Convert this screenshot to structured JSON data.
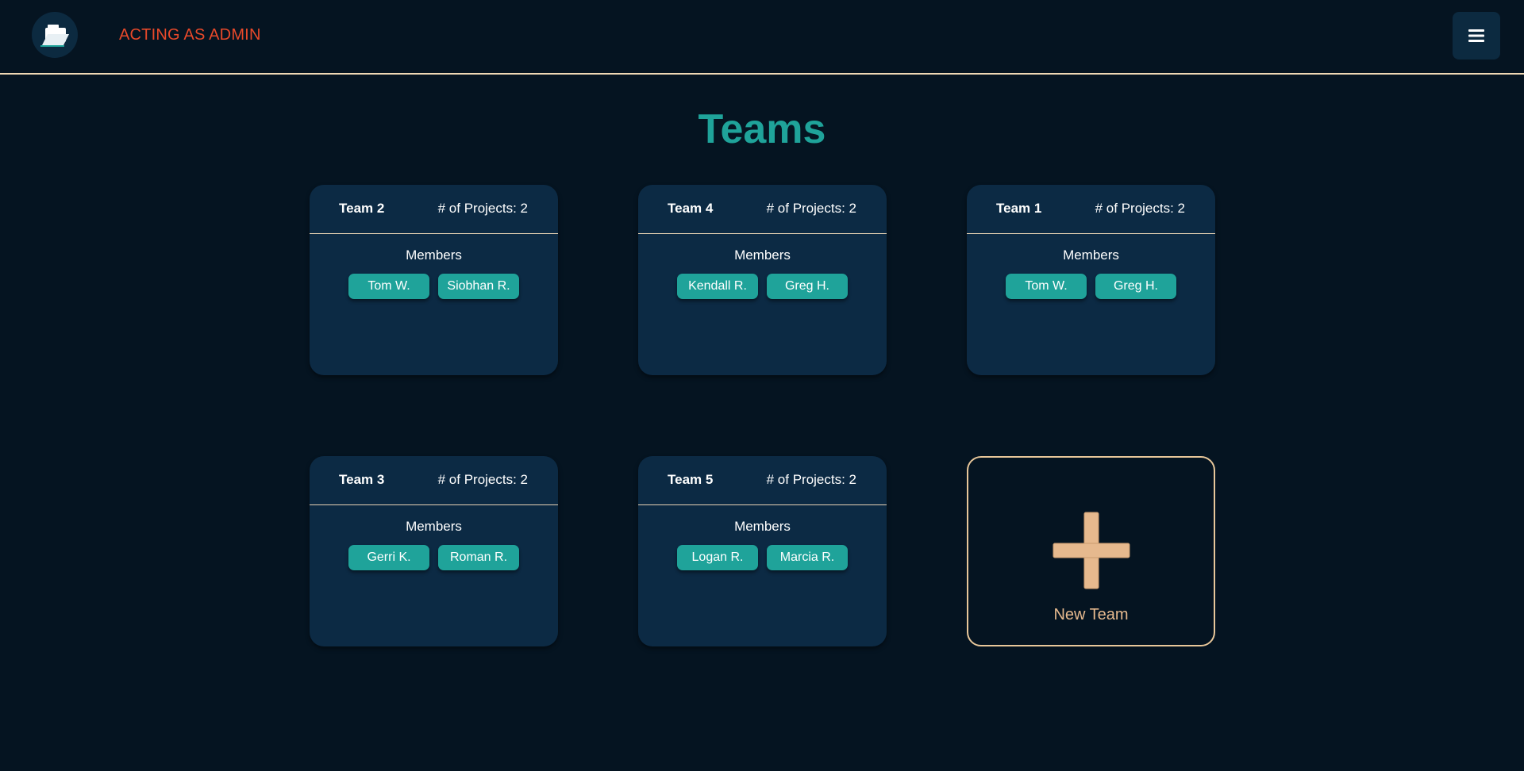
{
  "header": {
    "logo_icon": "folder-icon",
    "admin_label": "ACTING AS ADMIN",
    "menu_icon": "hamburger-menu-icon"
  },
  "page": {
    "title": "Teams"
  },
  "teams": [
    {
      "name": "Team 2",
      "projects_label": "# of Projects: 2",
      "members_label": "Members",
      "members": [
        "Tom W.",
        "Siobhan R."
      ]
    },
    {
      "name": "Team 4",
      "projects_label": "# of Projects: 2",
      "members_label": "Members",
      "members": [
        "Kendall R.",
        "Greg H."
      ]
    },
    {
      "name": "Team 1",
      "projects_label": "# of Projects: 2",
      "members_label": "Members",
      "members": [
        "Tom W.",
        "Greg H."
      ]
    },
    {
      "name": "Team 3",
      "projects_label": "# of Projects: 2",
      "members_label": "Members",
      "members": [
        "Gerri K.",
        "Roman R."
      ]
    },
    {
      "name": "Team 5",
      "projects_label": "# of Projects: 2",
      "members_label": "Members",
      "members": [
        "Logan R.",
        "Marcia R."
      ]
    }
  ],
  "new_team": {
    "icon": "plus-icon",
    "label": "New Team"
  },
  "colors": {
    "background": "#051421",
    "card": "#0c2a44",
    "accent_teal": "#1fa39a",
    "admin_red": "#e8492a",
    "sand": "#e6b98e"
  }
}
